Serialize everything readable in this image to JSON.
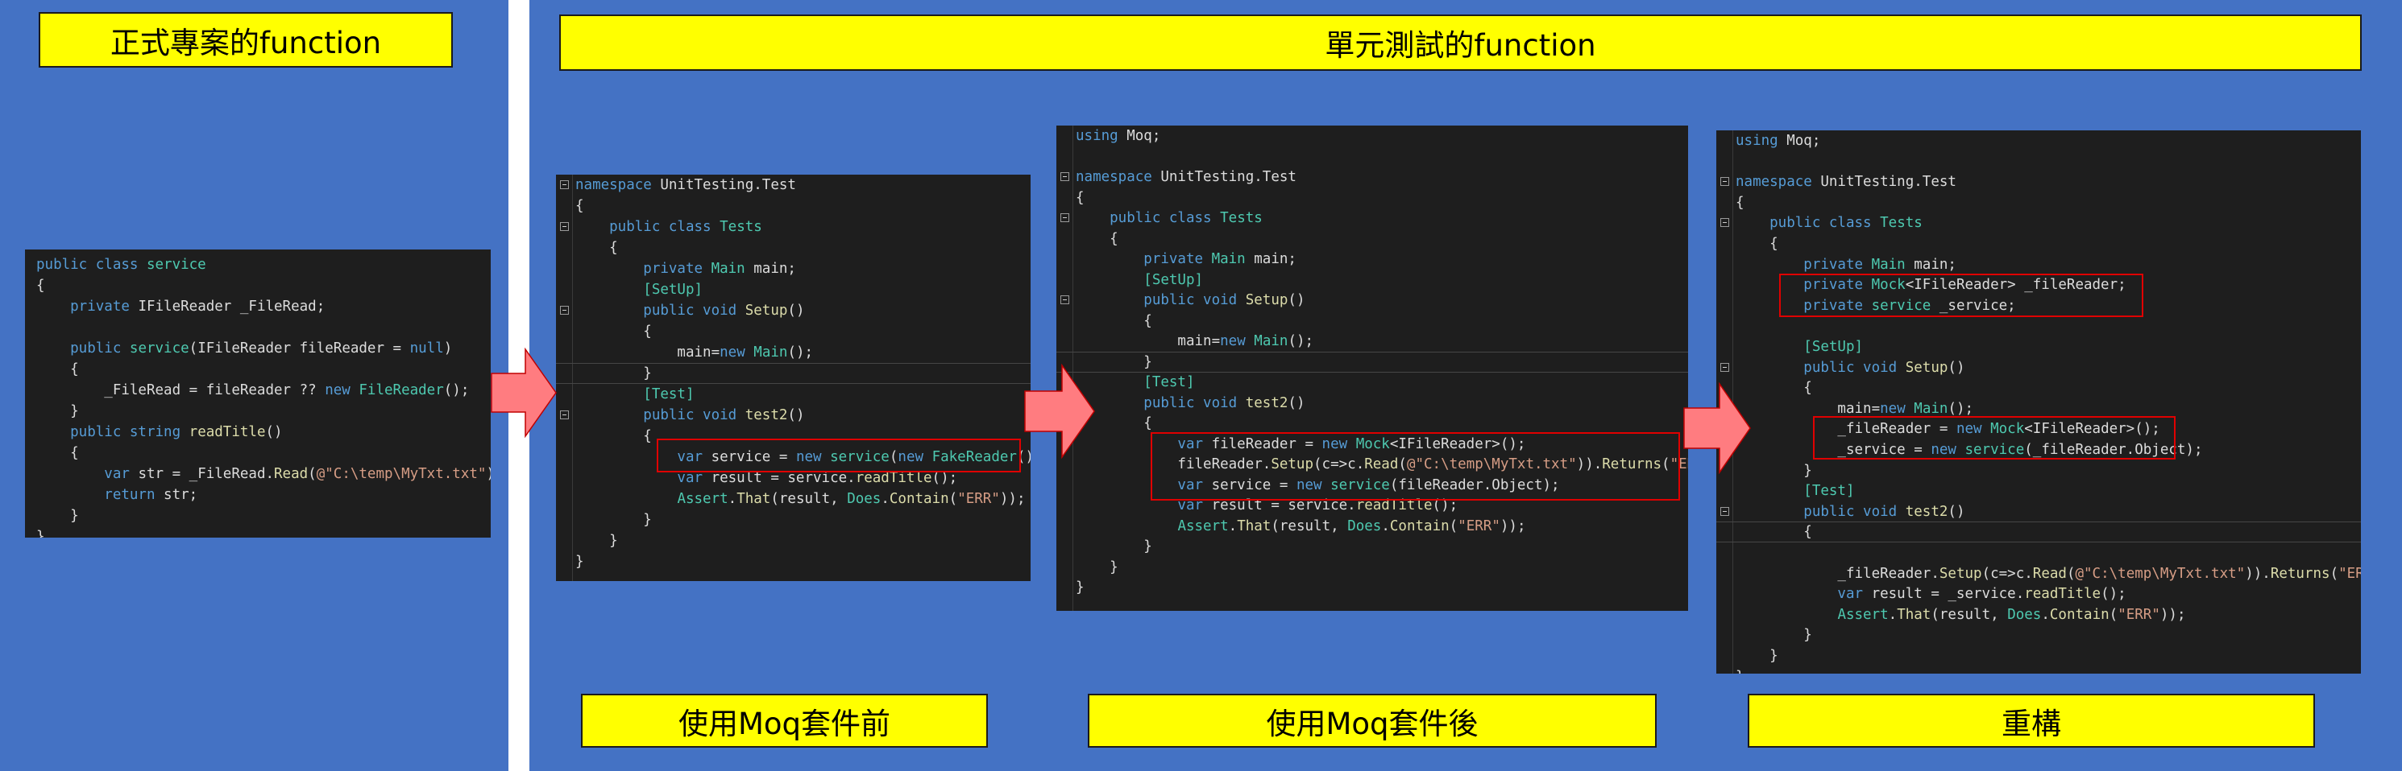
{
  "headers": {
    "production": "正式專案的function",
    "unittest": "單元測試的function"
  },
  "captions": {
    "before": "使用Moq套件前",
    "after": "使用Moq套件後",
    "refactor": "重構"
  },
  "code_production": [
    [
      {
        "t": "public class ",
        "c": "kw"
      },
      {
        "t": "service",
        "c": "type"
      }
    ],
    [
      {
        "t": "{",
        "c": "plain"
      }
    ],
    [
      {
        "t": "    private ",
        "c": "kw"
      },
      {
        "t": "IFileReader _FileRead;",
        "c": "plain"
      }
    ],
    [
      {
        "t": "",
        "c": "plain"
      }
    ],
    [
      {
        "t": "    public ",
        "c": "kw"
      },
      {
        "t": "service",
        "c": "type"
      },
      {
        "t": "(IFileReader fileReader = ",
        "c": "plain"
      },
      {
        "t": "null",
        "c": "kw"
      },
      {
        "t": ")",
        "c": "plain"
      }
    ],
    [
      {
        "t": "    {",
        "c": "plain"
      }
    ],
    [
      {
        "t": "        _FileRead = fileReader ?? ",
        "c": "plain"
      },
      {
        "t": "new ",
        "c": "kw"
      },
      {
        "t": "FileReader",
        "c": "type"
      },
      {
        "t": "();",
        "c": "plain"
      }
    ],
    [
      {
        "t": "    }",
        "c": "plain"
      }
    ],
    [
      {
        "t": "    public string ",
        "c": "kw"
      },
      {
        "t": "readTitle",
        "c": "fn"
      },
      {
        "t": "()",
        "c": "plain"
      }
    ],
    [
      {
        "t": "    {",
        "c": "plain"
      }
    ],
    [
      {
        "t": "        var ",
        "c": "kw"
      },
      {
        "t": "str = _FileRead.",
        "c": "plain"
      },
      {
        "t": "Read",
        "c": "fn"
      },
      {
        "t": "(",
        "c": "plain"
      },
      {
        "t": "@\"C:\\temp\\MyTxt.txt\"",
        "c": "str"
      },
      {
        "t": ");",
        "c": "plain"
      }
    ],
    [
      {
        "t": "        return ",
        "c": "kw"
      },
      {
        "t": "str;",
        "c": "plain"
      }
    ],
    [
      {
        "t": "    }",
        "c": "plain"
      }
    ],
    [
      {
        "t": "}",
        "c": "plain"
      }
    ]
  ],
  "code_before": [
    [
      {
        "t": "namespace ",
        "c": "kw"
      },
      {
        "t": "UnitTesting.Test",
        "c": "plain"
      }
    ],
    [
      {
        "t": "{",
        "c": "plain"
      }
    ],
    [
      {
        "t": "    public class ",
        "c": "kw"
      },
      {
        "t": "Tests",
        "c": "type"
      }
    ],
    [
      {
        "t": "    {",
        "c": "plain"
      }
    ],
    [
      {
        "t": "        private ",
        "c": "kw"
      },
      {
        "t": "Main ",
        "c": "type"
      },
      {
        "t": "main;",
        "c": "plain"
      }
    ],
    [
      {
        "t": "        [SetUp]",
        "c": "attr"
      }
    ],
    [
      {
        "t": "        public void ",
        "c": "kw"
      },
      {
        "t": "Setup",
        "c": "fn"
      },
      {
        "t": "()",
        "c": "plain"
      }
    ],
    [
      {
        "t": "        {",
        "c": "plain"
      }
    ],
    [
      {
        "t": "            main=",
        "c": "plain"
      },
      {
        "t": "new ",
        "c": "kw"
      },
      {
        "t": "Main",
        "c": "type"
      },
      {
        "t": "();",
        "c": "plain"
      }
    ],
    [
      {
        "t": "        }",
        "c": "plain"
      }
    ],
    [
      {
        "t": "        [Test]",
        "c": "attr"
      }
    ],
    [
      {
        "t": "        public void ",
        "c": "kw"
      },
      {
        "t": "test2",
        "c": "fn"
      },
      {
        "t": "()",
        "c": "plain"
      }
    ],
    [
      {
        "t": "        {",
        "c": "plain"
      }
    ],
    [
      {
        "t": "            var ",
        "c": "kw"
      },
      {
        "t": "service = ",
        "c": "plain"
      },
      {
        "t": "new ",
        "c": "kw"
      },
      {
        "t": "service",
        "c": "type"
      },
      {
        "t": "(",
        "c": "plain"
      },
      {
        "t": "new ",
        "c": "kw"
      },
      {
        "t": "FakeReader",
        "c": "type"
      },
      {
        "t": "());",
        "c": "plain"
      }
    ],
    [
      {
        "t": "            var ",
        "c": "kw"
      },
      {
        "t": "result = service.",
        "c": "plain"
      },
      {
        "t": "readTitle",
        "c": "fn"
      },
      {
        "t": "();",
        "c": "plain"
      }
    ],
    [
      {
        "t": "            ",
        "c": "plain"
      },
      {
        "t": "Assert",
        "c": "type"
      },
      {
        "t": ".",
        "c": "plain"
      },
      {
        "t": "That",
        "c": "fn"
      },
      {
        "t": "(result, ",
        "c": "plain"
      },
      {
        "t": "Does",
        "c": "type"
      },
      {
        "t": ".",
        "c": "plain"
      },
      {
        "t": "Contain",
        "c": "fn"
      },
      {
        "t": "(",
        "c": "plain"
      },
      {
        "t": "\"ERR\"",
        "c": "str"
      },
      {
        "t": "));",
        "c": "plain"
      }
    ],
    [
      {
        "t": "        }",
        "c": "plain"
      }
    ],
    [
      {
        "t": "    }",
        "c": "plain"
      }
    ],
    [
      {
        "t": "}",
        "c": "plain"
      }
    ]
  ],
  "code_after": [
    [
      {
        "t": "using ",
        "c": "kw"
      },
      {
        "t": "Moq;",
        "c": "plain"
      }
    ],
    [
      {
        "t": "",
        "c": "plain"
      }
    ],
    [
      {
        "t": "namespace ",
        "c": "kw"
      },
      {
        "t": "UnitTesting.Test",
        "c": "plain"
      }
    ],
    [
      {
        "t": "{",
        "c": "plain"
      }
    ],
    [
      {
        "t": "    public class ",
        "c": "kw"
      },
      {
        "t": "Tests",
        "c": "type"
      }
    ],
    [
      {
        "t": "    {",
        "c": "plain"
      }
    ],
    [
      {
        "t": "        private ",
        "c": "kw"
      },
      {
        "t": "Main ",
        "c": "type"
      },
      {
        "t": "main;",
        "c": "plain"
      }
    ],
    [
      {
        "t": "        [SetUp]",
        "c": "attr"
      }
    ],
    [
      {
        "t": "        public void ",
        "c": "kw"
      },
      {
        "t": "Setup",
        "c": "fn"
      },
      {
        "t": "()",
        "c": "plain"
      }
    ],
    [
      {
        "t": "        {",
        "c": "plain"
      }
    ],
    [
      {
        "t": "            main=",
        "c": "plain"
      },
      {
        "t": "new ",
        "c": "kw"
      },
      {
        "t": "Main",
        "c": "type"
      },
      {
        "t": "();",
        "c": "plain"
      }
    ],
    [
      {
        "t": "        }",
        "c": "plain"
      }
    ],
    [
      {
        "t": "        [Test]",
        "c": "attr"
      }
    ],
    [
      {
        "t": "        public void ",
        "c": "kw"
      },
      {
        "t": "test2",
        "c": "fn"
      },
      {
        "t": "()",
        "c": "plain"
      }
    ],
    [
      {
        "t": "        {",
        "c": "plain"
      }
    ],
    [
      {
        "t": "            var ",
        "c": "kw"
      },
      {
        "t": "fileReader = ",
        "c": "plain"
      },
      {
        "t": "new ",
        "c": "kw"
      },
      {
        "t": "Mock",
        "c": "type"
      },
      {
        "t": "<IFileReader>();",
        "c": "plain"
      }
    ],
    [
      {
        "t": "            fileReader.",
        "c": "plain"
      },
      {
        "t": "Setup",
        "c": "fn"
      },
      {
        "t": "(c=>c.",
        "c": "plain"
      },
      {
        "t": "Read",
        "c": "fn"
      },
      {
        "t": "(",
        "c": "plain"
      },
      {
        "t": "@\"C:\\temp\\MyTxt.txt\"",
        "c": "str"
      },
      {
        "t": ")).",
        "c": "plain"
      },
      {
        "t": "Returns",
        "c": "fn"
      },
      {
        "t": "(",
        "c": "plain"
      },
      {
        "t": "\"ERR\"",
        "c": "str"
      },
      {
        "t": ");",
        "c": "plain"
      }
    ],
    [
      {
        "t": "            var ",
        "c": "kw"
      },
      {
        "t": "service = ",
        "c": "plain"
      },
      {
        "t": "new ",
        "c": "kw"
      },
      {
        "t": "service",
        "c": "type"
      },
      {
        "t": "(fileReader.Object);",
        "c": "plain"
      }
    ],
    [
      {
        "t": "            var ",
        "c": "kw"
      },
      {
        "t": "result = service.",
        "c": "plain"
      },
      {
        "t": "readTitle",
        "c": "fn"
      },
      {
        "t": "();",
        "c": "plain"
      }
    ],
    [
      {
        "t": "            ",
        "c": "plain"
      },
      {
        "t": "Assert",
        "c": "type"
      },
      {
        "t": ".",
        "c": "plain"
      },
      {
        "t": "That",
        "c": "fn"
      },
      {
        "t": "(result, ",
        "c": "plain"
      },
      {
        "t": "Does",
        "c": "type"
      },
      {
        "t": ".",
        "c": "plain"
      },
      {
        "t": "Contain",
        "c": "fn"
      },
      {
        "t": "(",
        "c": "plain"
      },
      {
        "t": "\"ERR\"",
        "c": "str"
      },
      {
        "t": "));",
        "c": "plain"
      }
    ],
    [
      {
        "t": "        }",
        "c": "plain"
      }
    ],
    [
      {
        "t": "    }",
        "c": "plain"
      }
    ],
    [
      {
        "t": "}",
        "c": "plain"
      }
    ]
  ],
  "code_refactor": [
    [
      {
        "t": "using ",
        "c": "kw"
      },
      {
        "t": "Moq;",
        "c": "plain"
      }
    ],
    [
      {
        "t": "",
        "c": "plain"
      }
    ],
    [
      {
        "t": "namespace ",
        "c": "kw"
      },
      {
        "t": "UnitTesting.Test",
        "c": "plain"
      }
    ],
    [
      {
        "t": "{",
        "c": "plain"
      }
    ],
    [
      {
        "t": "    public class ",
        "c": "kw"
      },
      {
        "t": "Tests",
        "c": "type"
      }
    ],
    [
      {
        "t": "    {",
        "c": "plain"
      }
    ],
    [
      {
        "t": "        private ",
        "c": "kw"
      },
      {
        "t": "Main ",
        "c": "type"
      },
      {
        "t": "main;",
        "c": "plain"
      }
    ],
    [
      {
        "t": "        private ",
        "c": "kw"
      },
      {
        "t": "Mock",
        "c": "type"
      },
      {
        "t": "<IFileReader> _fileReader;",
        "c": "plain"
      }
    ],
    [
      {
        "t": "        private ",
        "c": "kw"
      },
      {
        "t": "service ",
        "c": "type"
      },
      {
        "t": "_service;",
        "c": "plain"
      }
    ],
    [
      {
        "t": "",
        "c": "plain"
      }
    ],
    [
      {
        "t": "        [SetUp]",
        "c": "attr"
      }
    ],
    [
      {
        "t": "        public void ",
        "c": "kw"
      },
      {
        "t": "Setup",
        "c": "fn"
      },
      {
        "t": "()",
        "c": "plain"
      }
    ],
    [
      {
        "t": "        {",
        "c": "plain"
      }
    ],
    [
      {
        "t": "            main=",
        "c": "plain"
      },
      {
        "t": "new ",
        "c": "kw"
      },
      {
        "t": "Main",
        "c": "type"
      },
      {
        "t": "();",
        "c": "plain"
      }
    ],
    [
      {
        "t": "            _fileReader = ",
        "c": "plain"
      },
      {
        "t": "new ",
        "c": "kw"
      },
      {
        "t": "Mock",
        "c": "type"
      },
      {
        "t": "<IFileReader>();",
        "c": "plain"
      }
    ],
    [
      {
        "t": "            _service = ",
        "c": "plain"
      },
      {
        "t": "new ",
        "c": "kw"
      },
      {
        "t": "service",
        "c": "type"
      },
      {
        "t": "(_fileReader.Object);",
        "c": "plain"
      }
    ],
    [
      {
        "t": "        }",
        "c": "plain"
      }
    ],
    [
      {
        "t": "        [Test]",
        "c": "attr"
      }
    ],
    [
      {
        "t": "        public void ",
        "c": "kw"
      },
      {
        "t": "test2",
        "c": "fn"
      },
      {
        "t": "()",
        "c": "plain"
      }
    ],
    [
      {
        "t": "        {",
        "c": "plain"
      }
    ],
    [
      {
        "t": "",
        "c": "plain"
      }
    ],
    [
      {
        "t": "            _fileReader.",
        "c": "plain"
      },
      {
        "t": "Setup",
        "c": "fn"
      },
      {
        "t": "(c=>c.",
        "c": "plain"
      },
      {
        "t": "Read",
        "c": "fn"
      },
      {
        "t": "(",
        "c": "plain"
      },
      {
        "t": "@\"C:\\temp\\MyTxt.txt\"",
        "c": "str"
      },
      {
        "t": ")).",
        "c": "plain"
      },
      {
        "t": "Returns",
        "c": "fn"
      },
      {
        "t": "(",
        "c": "plain"
      },
      {
        "t": "\"ERR\"",
        "c": "str"
      },
      {
        "t": ");",
        "c": "plain"
      }
    ],
    [
      {
        "t": "            var ",
        "c": "kw"
      },
      {
        "t": "result = _service.",
        "c": "plain"
      },
      {
        "t": "readTitle",
        "c": "fn"
      },
      {
        "t": "();",
        "c": "plain"
      }
    ],
    [
      {
        "t": "            ",
        "c": "plain"
      },
      {
        "t": "Assert",
        "c": "type"
      },
      {
        "t": ".",
        "c": "plain"
      },
      {
        "t": "That",
        "c": "fn"
      },
      {
        "t": "(result, ",
        "c": "plain"
      },
      {
        "t": "Does",
        "c": "type"
      },
      {
        "t": ".",
        "c": "plain"
      },
      {
        "t": "Contain",
        "c": "fn"
      },
      {
        "t": "(",
        "c": "plain"
      },
      {
        "t": "\"ERR\"",
        "c": "str"
      },
      {
        "t": "));",
        "c": "plain"
      }
    ],
    [
      {
        "t": "        }",
        "c": "plain"
      }
    ],
    [
      {
        "t": "    }",
        "c": "plain"
      }
    ],
    [
      {
        "t": "}",
        "c": "plain"
      }
    ]
  ],
  "colors": {
    "panel": "#4472C4",
    "label": "#FFFF00",
    "editor_bg": "#1E1E1E",
    "arrow": "#FF7C80",
    "highlight": "#E00000"
  }
}
